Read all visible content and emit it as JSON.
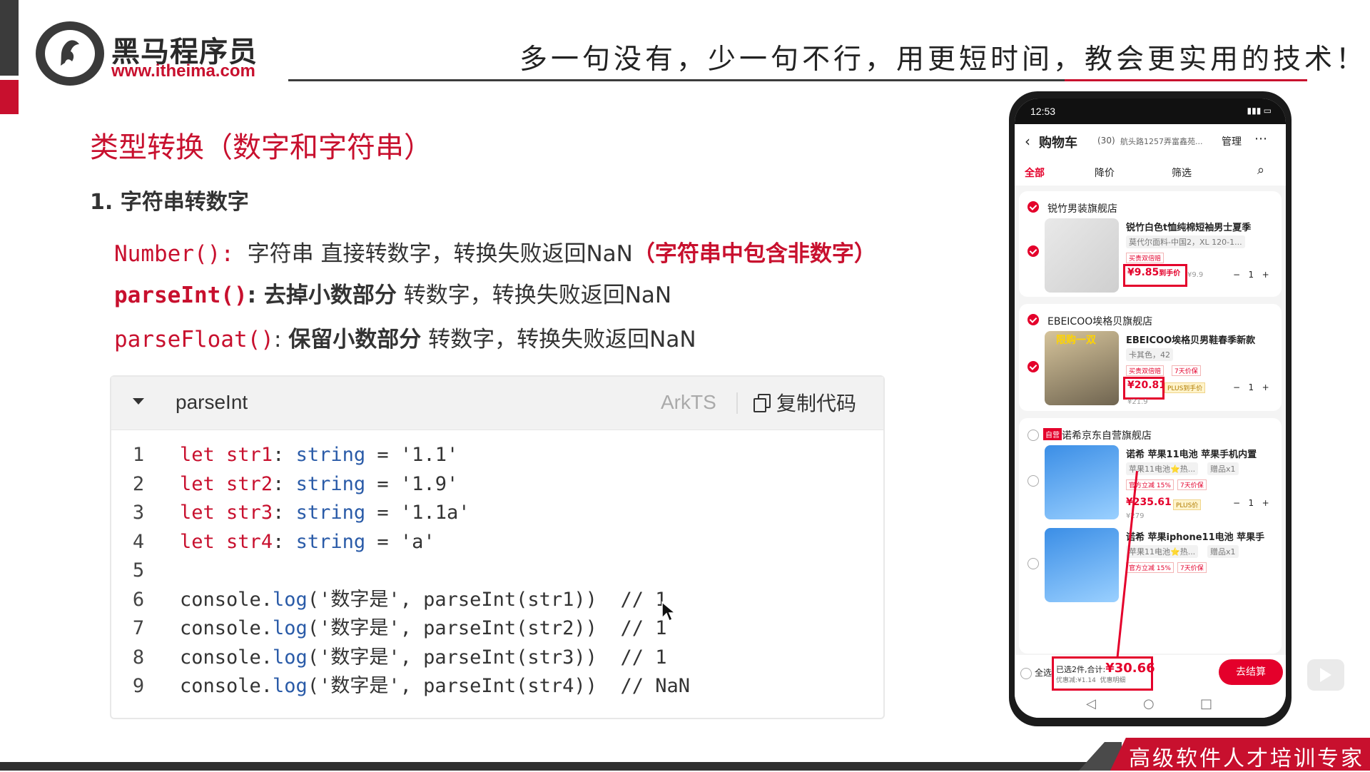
{
  "header": {
    "brand_name": "黑马程序员",
    "brand_url": "www.itheima.com",
    "slogan": "多一句没有，少一句不行，用更短时间，教会更实用的技术！"
  },
  "content": {
    "section_title": "类型转换（数字和字符串）",
    "subsection": "1. 字符串转数字",
    "lines": [
      {
        "fn": "Number()",
        "colon": ": ",
        "desc": "字符串 直接转数字，转换失败返回NaN",
        "note": "（字符串中包含非数字）"
      },
      {
        "fn": "parseInt()",
        "colon": ": ",
        "desc_bold": "去掉小数部分",
        "desc": " 转数字，转换失败返回NaN"
      },
      {
        "fn": "parseFloat()",
        "colon": ": ",
        "desc_bold": "保留小数部分",
        "desc": " 转数字，转换失败返回NaN"
      }
    ]
  },
  "code_card": {
    "title": "parseInt",
    "lang": "ArkTS",
    "copy_label": "复制代码",
    "lines": [
      {
        "n": "1",
        "kw": "let",
        "var": "str1",
        "type": "string",
        "val": "'1.1'"
      },
      {
        "n": "2",
        "kw": "let",
        "var": "str2",
        "type": "string",
        "val": "'1.9'"
      },
      {
        "n": "3",
        "kw": "let",
        "var": "str3",
        "type": "string",
        "val": "'1.1a'"
      },
      {
        "n": "4",
        "kw": "let",
        "var": "str4",
        "type": "string",
        "val": "'a'"
      },
      {
        "n": "5"
      },
      {
        "n": "6",
        "obj": "console.",
        "method": "log",
        "args": "('数字是', parseInt(str1))",
        "comment": "  // 1"
      },
      {
        "n": "7",
        "obj": "console.",
        "method": "log",
        "args": "('数字是', parseInt(str2))",
        "comment": "  // 1"
      },
      {
        "n": "8",
        "obj": "console.",
        "method": "log",
        "args": "('数字是', parseInt(str3))",
        "comment": "  // 1"
      },
      {
        "n": "9",
        "obj": "console.",
        "method": "log",
        "args": "('数字是', parseInt(str4))",
        "comment": "  // NaN"
      }
    ]
  },
  "phone": {
    "time": "12:53",
    "cart_title": "购物车",
    "cart_count": "(30)",
    "address": "航头路1257弄富鑫苑...",
    "manage": "管理",
    "tabs": [
      "全部",
      "降价",
      "筛选"
    ],
    "shop1": {
      "name": "锐竹男装旗舰店",
      "item_title": "锐竹白色t恤纯棉短袖男士夏季",
      "spec": "莫代尔面料-中国2，XL 120-1...",
      "tag": "买贵双倍赔",
      "price": "¥9.85",
      "price_label": "到手价",
      "orig": "¥9.9",
      "qty": "1"
    },
    "shop2": {
      "name": "EBEICOO埃格贝旗舰店",
      "item_title": "EBEICOO埃格贝男鞋春季新款",
      "spec": "卡其色，42",
      "tag1": "买贵双倍赔",
      "tag2": "7天价保",
      "badge": "限购一双",
      "price": "¥20.81",
      "price_label": "PLUS到手价",
      "orig": "¥21.9",
      "qty": "1"
    },
    "shop3": {
      "self": "自营",
      "name": "诺希京东自营旗舰店",
      "item1_title": "诺希 苹果11电池 苹果手机内置",
      "item1_spec": "苹果11电池⭐热...",
      "item1_gift": "赠品x1",
      "item1_tag1": "官方立减 15%",
      "item1_tag2": "7天价保",
      "item1_price": "¥235.61",
      "item1_plus": "PLUS价",
      "item1_orig": "¥279",
      "item1_qty": "1",
      "item2_title": "诺希 苹果iphone11电池 苹果手",
      "item2_spec": "苹果11电池⭐热...",
      "item2_gift": "赠品x1",
      "item2_tag1": "官方立减 15%",
      "item2_tag2": "7天价保"
    },
    "select_all": "全选",
    "total_label": "已选2件,合计:",
    "total_value": "¥30.66",
    "discount": "优惠减:¥1.14",
    "discount_detail": "优惠明细",
    "checkout": "去结算"
  },
  "footer": {
    "banner": "高级软件人才培训专家"
  },
  "colors": {
    "brand_red": "#c8102e",
    "jd_red": "#e4002b",
    "code_blue": "#2a5ba8"
  }
}
